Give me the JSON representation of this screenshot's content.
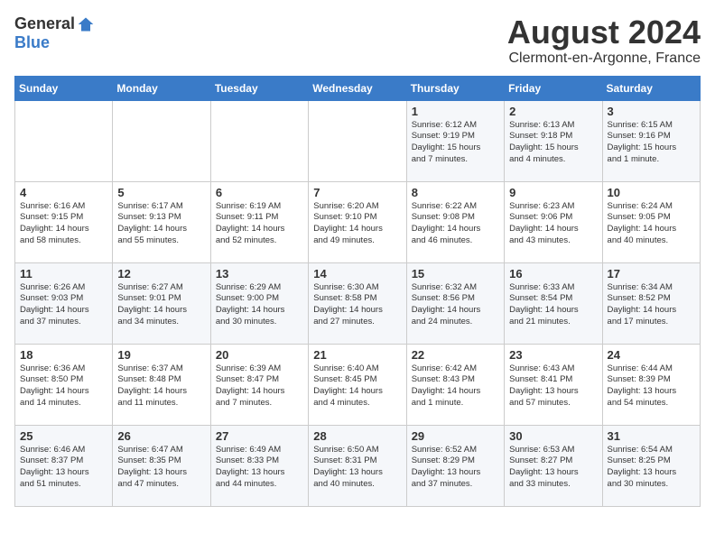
{
  "logo": {
    "general": "General",
    "blue": "Blue"
  },
  "title": {
    "month_year": "August 2024",
    "location": "Clermont-en-Argonne, France"
  },
  "days_of_week": [
    "Sunday",
    "Monday",
    "Tuesday",
    "Wednesday",
    "Thursday",
    "Friday",
    "Saturday"
  ],
  "weeks": [
    [
      {
        "day": "",
        "info": ""
      },
      {
        "day": "",
        "info": ""
      },
      {
        "day": "",
        "info": ""
      },
      {
        "day": "",
        "info": ""
      },
      {
        "day": "1",
        "info": "Sunrise: 6:12 AM\nSunset: 9:19 PM\nDaylight: 15 hours\nand 7 minutes."
      },
      {
        "day": "2",
        "info": "Sunrise: 6:13 AM\nSunset: 9:18 PM\nDaylight: 15 hours\nand 4 minutes."
      },
      {
        "day": "3",
        "info": "Sunrise: 6:15 AM\nSunset: 9:16 PM\nDaylight: 15 hours\nand 1 minute."
      }
    ],
    [
      {
        "day": "4",
        "info": "Sunrise: 6:16 AM\nSunset: 9:15 PM\nDaylight: 14 hours\nand 58 minutes."
      },
      {
        "day": "5",
        "info": "Sunrise: 6:17 AM\nSunset: 9:13 PM\nDaylight: 14 hours\nand 55 minutes."
      },
      {
        "day": "6",
        "info": "Sunrise: 6:19 AM\nSunset: 9:11 PM\nDaylight: 14 hours\nand 52 minutes."
      },
      {
        "day": "7",
        "info": "Sunrise: 6:20 AM\nSunset: 9:10 PM\nDaylight: 14 hours\nand 49 minutes."
      },
      {
        "day": "8",
        "info": "Sunrise: 6:22 AM\nSunset: 9:08 PM\nDaylight: 14 hours\nand 46 minutes."
      },
      {
        "day": "9",
        "info": "Sunrise: 6:23 AM\nSunset: 9:06 PM\nDaylight: 14 hours\nand 43 minutes."
      },
      {
        "day": "10",
        "info": "Sunrise: 6:24 AM\nSunset: 9:05 PM\nDaylight: 14 hours\nand 40 minutes."
      }
    ],
    [
      {
        "day": "11",
        "info": "Sunrise: 6:26 AM\nSunset: 9:03 PM\nDaylight: 14 hours\nand 37 minutes."
      },
      {
        "day": "12",
        "info": "Sunrise: 6:27 AM\nSunset: 9:01 PM\nDaylight: 14 hours\nand 34 minutes."
      },
      {
        "day": "13",
        "info": "Sunrise: 6:29 AM\nSunset: 9:00 PM\nDaylight: 14 hours\nand 30 minutes."
      },
      {
        "day": "14",
        "info": "Sunrise: 6:30 AM\nSunset: 8:58 PM\nDaylight: 14 hours\nand 27 minutes."
      },
      {
        "day": "15",
        "info": "Sunrise: 6:32 AM\nSunset: 8:56 PM\nDaylight: 14 hours\nand 24 minutes."
      },
      {
        "day": "16",
        "info": "Sunrise: 6:33 AM\nSunset: 8:54 PM\nDaylight: 14 hours\nand 21 minutes."
      },
      {
        "day": "17",
        "info": "Sunrise: 6:34 AM\nSunset: 8:52 PM\nDaylight: 14 hours\nand 17 minutes."
      }
    ],
    [
      {
        "day": "18",
        "info": "Sunrise: 6:36 AM\nSunset: 8:50 PM\nDaylight: 14 hours\nand 14 minutes."
      },
      {
        "day": "19",
        "info": "Sunrise: 6:37 AM\nSunset: 8:48 PM\nDaylight: 14 hours\nand 11 minutes."
      },
      {
        "day": "20",
        "info": "Sunrise: 6:39 AM\nSunset: 8:47 PM\nDaylight: 14 hours\nand 7 minutes."
      },
      {
        "day": "21",
        "info": "Sunrise: 6:40 AM\nSunset: 8:45 PM\nDaylight: 14 hours\nand 4 minutes."
      },
      {
        "day": "22",
        "info": "Sunrise: 6:42 AM\nSunset: 8:43 PM\nDaylight: 14 hours\nand 1 minute."
      },
      {
        "day": "23",
        "info": "Sunrise: 6:43 AM\nSunset: 8:41 PM\nDaylight: 13 hours\nand 57 minutes."
      },
      {
        "day": "24",
        "info": "Sunrise: 6:44 AM\nSunset: 8:39 PM\nDaylight: 13 hours\nand 54 minutes."
      }
    ],
    [
      {
        "day": "25",
        "info": "Sunrise: 6:46 AM\nSunset: 8:37 PM\nDaylight: 13 hours\nand 51 minutes."
      },
      {
        "day": "26",
        "info": "Sunrise: 6:47 AM\nSunset: 8:35 PM\nDaylight: 13 hours\nand 47 minutes."
      },
      {
        "day": "27",
        "info": "Sunrise: 6:49 AM\nSunset: 8:33 PM\nDaylight: 13 hours\nand 44 minutes."
      },
      {
        "day": "28",
        "info": "Sunrise: 6:50 AM\nSunset: 8:31 PM\nDaylight: 13 hours\nand 40 minutes."
      },
      {
        "day": "29",
        "info": "Sunrise: 6:52 AM\nSunset: 8:29 PM\nDaylight: 13 hours\nand 37 minutes."
      },
      {
        "day": "30",
        "info": "Sunrise: 6:53 AM\nSunset: 8:27 PM\nDaylight: 13 hours\nand 33 minutes."
      },
      {
        "day": "31",
        "info": "Sunrise: 6:54 AM\nSunset: 8:25 PM\nDaylight: 13 hours\nand 30 minutes."
      }
    ]
  ]
}
